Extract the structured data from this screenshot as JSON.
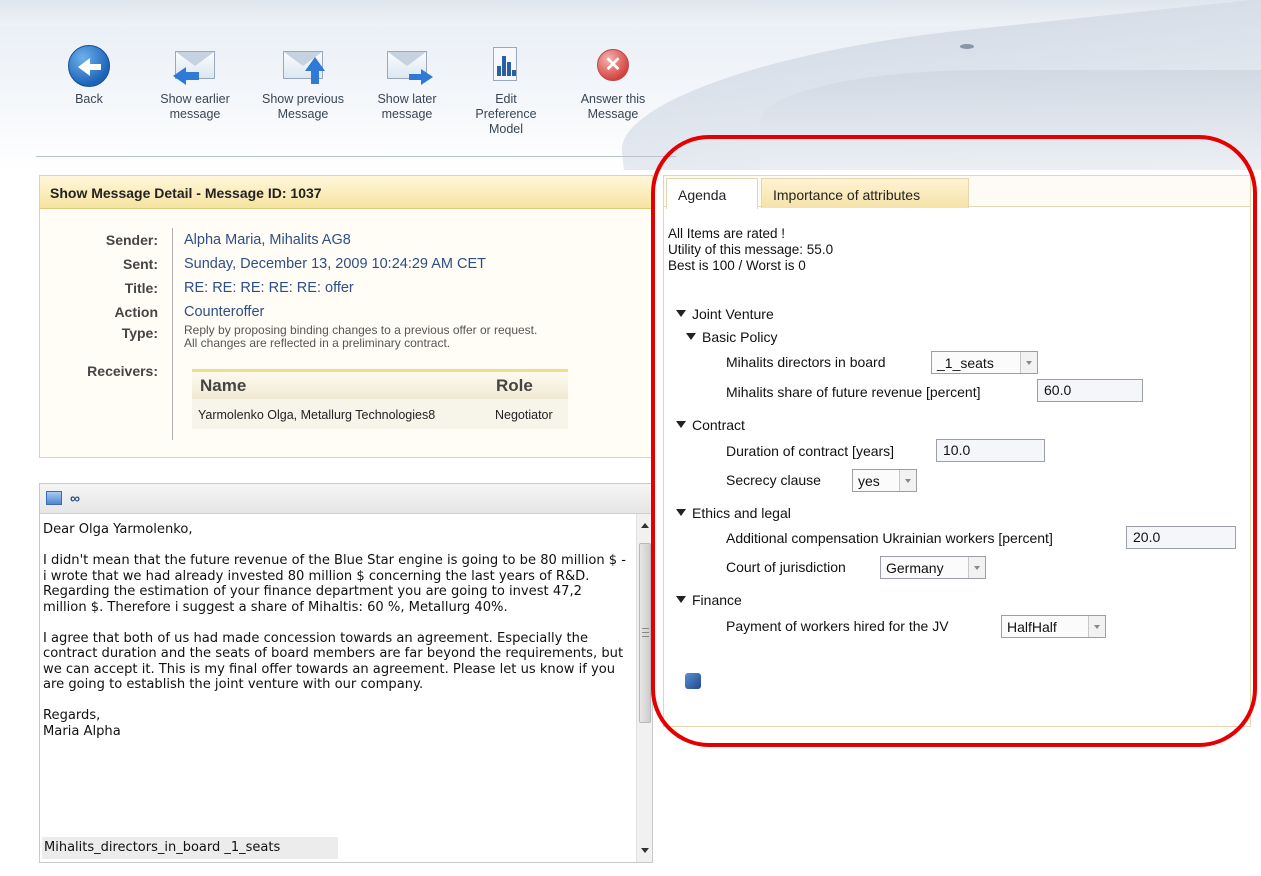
{
  "toolbar": {
    "back_label": "Back",
    "earlier_label": "Show earlier\nmessage",
    "previous_label": "Show previous\nMessage",
    "later_label": "Show later\nmessage",
    "edit_pref_label": "Edit\nPreference\nModel",
    "answer_label": "Answer this\nMessage",
    "icons": {
      "back": "back-arrow-icon",
      "earlier": "envelope-left-arrow-icon",
      "previous": "envelope-up-arrow-icon",
      "later": "envelope-right-arrow-icon",
      "edit": "preference-chart-icon",
      "answer": "red-x-icon"
    }
  },
  "detail": {
    "title": "Show Message Detail - Message ID: 1037",
    "sender_label": "Sender:",
    "sender": "Alpha Maria, Mihalits AG8",
    "sent_label": "Sent:",
    "sent": "Sunday, December 13, 2009 10:24:29 AM CET",
    "title_label": "Title:",
    "title_value": "RE: RE: RE: RE: RE: offer",
    "action_label": "Action",
    "type_label": "Type:",
    "action_type": "Counteroffer",
    "action_desc_1": "Reply by proposing binding changes to a previous offer or request.",
    "action_desc_2": "All changes are reflected in a preliminary contract.",
    "receivers_label": "Receivers:",
    "receivers_table": {
      "headers": [
        "Name",
        "Role"
      ],
      "rows": [
        [
          "Yarmolenko Olga, Metallurg Technologies8",
          "Negotiator"
        ]
      ]
    }
  },
  "body": {
    "greeting": "Dear Olga Yarmolenko,",
    "paragraph_1": "I didn't mean that the future revenue of the Blue Star engine is going to be 80 million $ - i wrote that we had already invested 80 million $ concerning the last years of R&D. Regarding the estimation of your finance department you are going to invest 47,2 million $. Therefore i suggest a share of Mihaltis: 60 %, Metallurg 40%.",
    "paragraph_2": "I agree that both of us had made concession towards an agreement. Especially the contract duration and the seats of board members are far beyond the requirements, but we can accept it. This is my final offer towards an agreement. Please let us know if you are going to establish the joint venture with our company.",
    "signoff": "Regards,\nMaria Alpha",
    "code_line": "Mihalits_directors_in_board  _1_seats"
  },
  "agenda": {
    "tabs": [
      "Agenda",
      "Importance of attributes"
    ],
    "active_tab": "Agenda",
    "status_1": "All Items are rated !",
    "status_2": "Utility of this message: 55.0",
    "status_3": "Best is 100 / Worst is 0",
    "root": "Joint Venture",
    "basic_policy": "Basic Policy",
    "directors_label": "Mihalits directors in board",
    "directors_value": "_1_seats",
    "share_label": "Mihalits share of future revenue [percent]",
    "share_value": "60.0",
    "contract": "Contract",
    "duration_label": "Duration of contract [years]",
    "duration_value": "10.0",
    "secrecy_label": "Secrecy clause",
    "secrecy_value": "yes",
    "ethics": "Ethics and legal",
    "compensation_label": "Additional compensation Ukrainian workers [percent]",
    "compensation_value": "20.0",
    "court_label": "Court of jurisdiction",
    "court_value": "Germany",
    "finance": "Finance",
    "payment_label": "Payment of workers hired for the JV",
    "payment_value": "HalfHalf"
  },
  "colors": {
    "annotation": "#e40000",
    "accent_blue": "#2d4f86",
    "header_yellow": "#f6e3a1"
  }
}
